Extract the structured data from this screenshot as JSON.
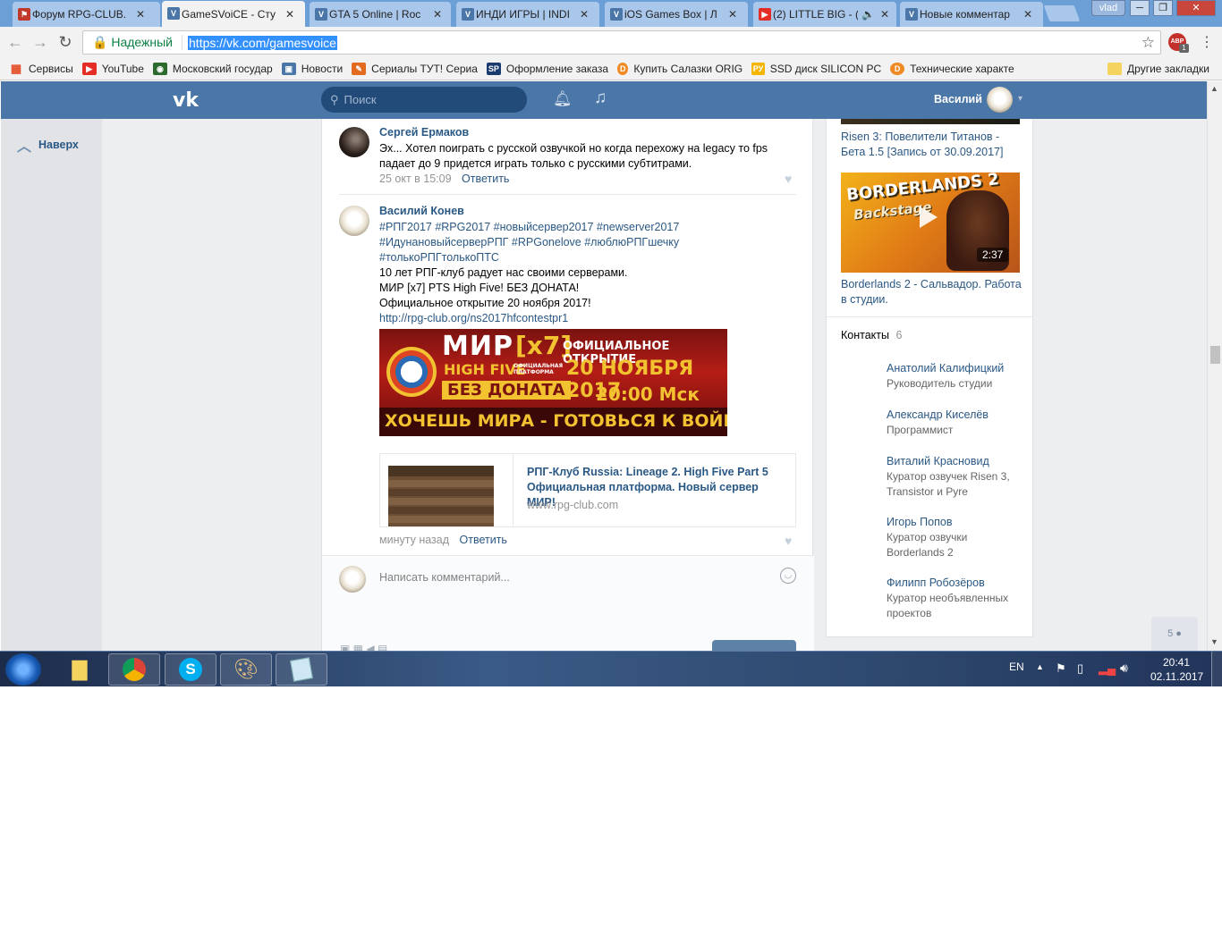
{
  "browser": {
    "tabs": [
      {
        "title": "Форум RPG-CLUB.",
        "fav": "flag",
        "color": "#c0392b"
      },
      {
        "title": "GameSVoiCE - Сту",
        "fav": "vk",
        "color": "#4a76a8"
      },
      {
        "title": "GTA 5 Online | Roc",
        "fav": "vk",
        "color": "#4a76a8"
      },
      {
        "title": "ИНДИ ИГРЫ | INDI",
        "fav": "vk",
        "color": "#4a76a8"
      },
      {
        "title": "iOS Games Box | Л",
        "fav": "vk",
        "color": "#4a76a8"
      },
      {
        "title": "(2) LITTLE BIG - (",
        "fav": "youtube",
        "color": "#e52d27"
      },
      {
        "title": "Новые комментар",
        "fav": "vk",
        "color": "#4a76a8"
      }
    ],
    "profile": "vlad",
    "secure_label": "Надежный",
    "url": "https://vk.com/gamesvoice",
    "abp_count": "1",
    "bookmarks": [
      {
        "label": "Сервисы",
        "color": "#e44d26",
        "glyph": "▦"
      },
      {
        "label": "YouTube",
        "color": "#e52d27",
        "glyph": "▶"
      },
      {
        "label": "Московский государ",
        "color": "#2d6a2d",
        "glyph": "◉"
      },
      {
        "label": "Новости",
        "color": "#4a76a8",
        "glyph": "▣"
      },
      {
        "label": "Сериалы ТУТ! Сериа",
        "color": "#e26b1f",
        "glyph": "✎"
      },
      {
        "label": "Оформление заказа",
        "color": "#1b3b6f",
        "glyph": "SP"
      },
      {
        "label": "Купить Салазки ORIG",
        "color": "#f08a24",
        "glyph": "D"
      },
      {
        "label": "SSD диск SILICON PC",
        "color": "#f4b400",
        "glyph": "РУ"
      },
      {
        "label": "Технические характе",
        "color": "#f08a24",
        "glyph": "D"
      }
    ],
    "other_bookmarks": "Другие закладки"
  },
  "vk": {
    "search_placeholder": "Поиск",
    "user_name": "Василий",
    "back_up": "Наверх",
    "comments": [
      {
        "author": "Сергей Ермаков",
        "text": "Эх... Хотел поиграть с русской озвучкой но когда перехожу на legacy то fps падает до 9 придется играть только с русскими субтитрами.",
        "time": "25 окт в 15:09",
        "reply": "Ответить"
      },
      {
        "author": "Василий Конев",
        "hashtags_line1": "#РПГ2017 #RPG2017 #новыйсервер2017 #newserver2017",
        "hashtags_line2": "#ИдунановыйсерверРПГ #RPGonelove #люблюРПГшечку",
        "hashtags_line3": "#толькоРПГтолькоПТС",
        "line1": "10 лет РПГ-клуб радует нас своими серверами.",
        "line2": "МИР [x7] PTS High Five! БЕЗ ДОНАТА!",
        "line3": "Официальное открытие 20 ноября 2017!",
        "link": "http://rpg-club.org/ns2017hfcontestpr1",
        "banner": {
          "world": "МИР",
          "rate": "[x7]",
          "highfive": "HIGH FIVE",
          "platform": "ОФИЦИАЛЬНАЯ ПЛАТФОРМА",
          "opening": "ОФИЦИАЛЬНОЕ ОТКРЫТИЕ",
          "date": "20 НОЯБРЯ 2017",
          "time": "20:00 Мск",
          "nodonate": "БЕЗ ДОНАТА",
          "slogan": "ХОЧЕШЬ МИРА - ГОТОВЬСЯ К ВОЙНЕ"
        },
        "snippet_title": "РПГ-Клуб Russia: Lineage 2. High Five Part 5 Официальная платформа. Новый сервер МИР!",
        "snippet_domain": "www.rpg-club.com",
        "time": "минуту назад",
        "reply": "Ответить"
      }
    ],
    "comment_placeholder": "Написать комментарий...",
    "videos": [
      {
        "title": "Risen 3: Повелители Титанов - Бета 1.5 [Запись от 30.09.2017]"
      },
      {
        "title": "Borderlands 2 - Сальвадор. Работа в студии.",
        "duration": "2:37",
        "thumb_text": "BORDERLANDS 2",
        "thumb_sub": "Backstage"
      }
    ],
    "contacts_label": "Контакты",
    "contacts_count": "6",
    "contacts": [
      {
        "name": "Анатолий Калифицкий",
        "role": "Руководитель студии"
      },
      {
        "name": "Александр Киселёв",
        "role": "Программист"
      },
      {
        "name": "Виталий Красновид",
        "role": "Куратор озвучек Risen 3, Transistor и Pyre"
      },
      {
        "name": "Игорь Попов",
        "role": "Куратор озвучки Borderlands 2"
      },
      {
        "name": "Филипп Робозёров",
        "role": "Куратор необъявленных проектов"
      }
    ],
    "online_count": "5"
  },
  "taskbar": {
    "lang": "EN",
    "time": "20:41",
    "date": "02.11.2017"
  }
}
